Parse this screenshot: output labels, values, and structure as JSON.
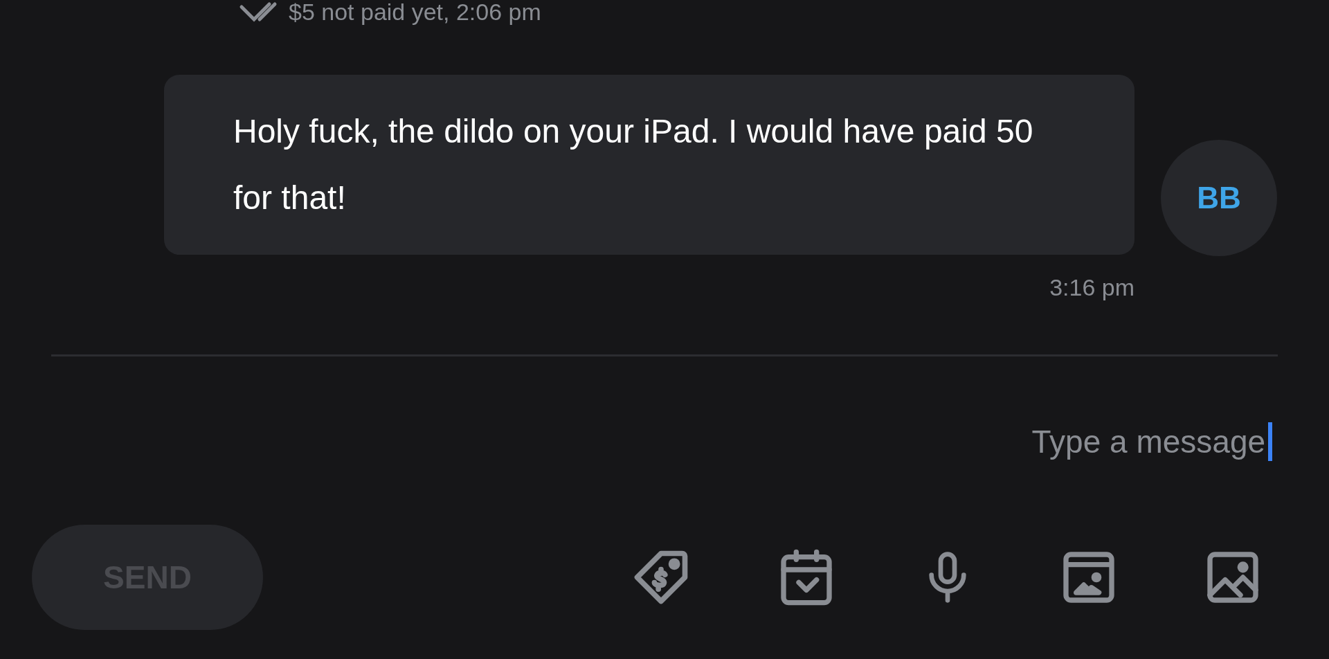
{
  "previous_status": "$5 not paid yet, 2:06 pm",
  "message": {
    "text": "Holy fuck, the dildo on your iPad. I would have paid 50 for that!",
    "time": "3:16 pm",
    "avatar": "BB"
  },
  "composer": {
    "placeholder": "Type a message"
  },
  "send_button": {
    "label": "SEND",
    "disabled": true
  }
}
